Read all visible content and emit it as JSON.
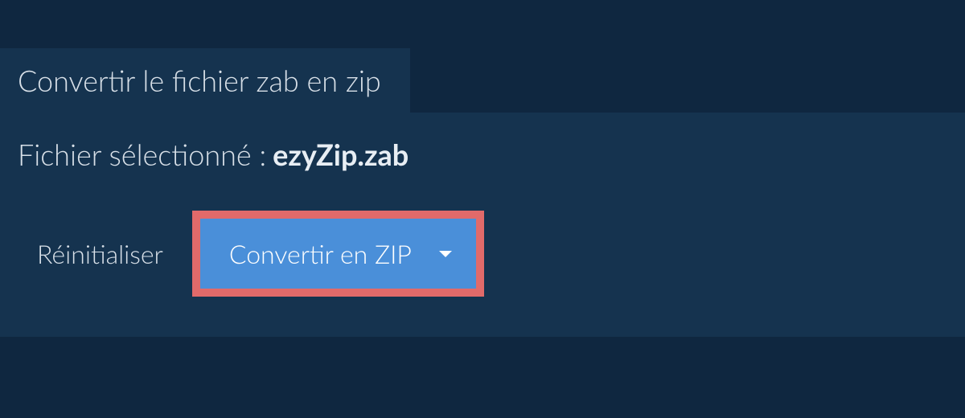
{
  "tab": {
    "title": "Convertir le fichier zab en zip"
  },
  "selected_file": {
    "label": "Fichier sélectionné : ",
    "name": "ezyZip.zab"
  },
  "actions": {
    "reset_label": "Réinitialiser",
    "convert_label": "Convertir en ZIP"
  },
  "colors": {
    "highlight_border": "#e16a6a",
    "button_bg": "#4a8fd9",
    "page_bg": "#0f2740",
    "panel_bg": "#15334f"
  }
}
